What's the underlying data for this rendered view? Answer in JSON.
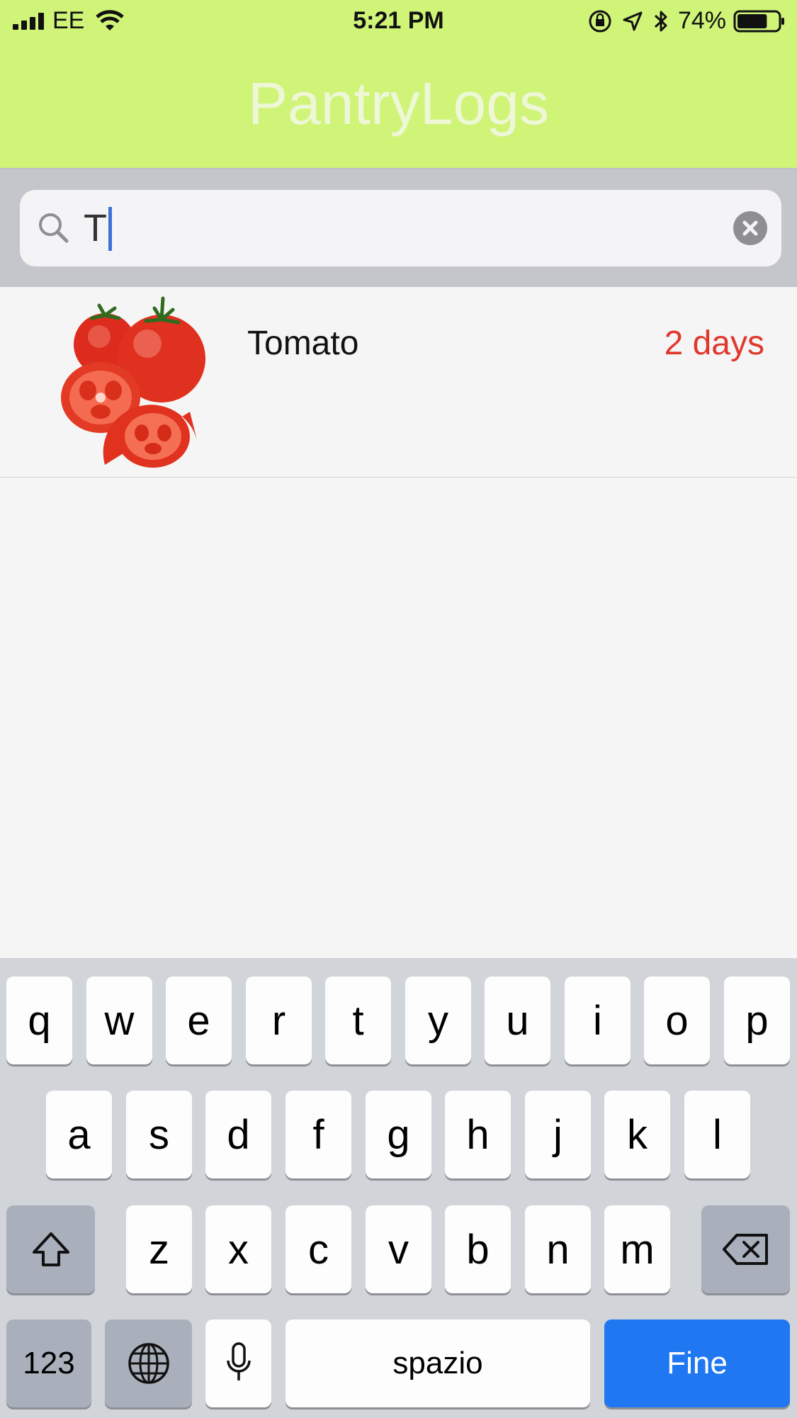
{
  "status_bar": {
    "carrier": "EE",
    "time": "5:21 PM",
    "battery": "74%",
    "battery_level": 0.74,
    "icons": [
      "signal-icon",
      "wifi-icon",
      "orientation-lock-icon",
      "location-icon",
      "bluetooth-icon",
      "battery-icon"
    ]
  },
  "header": {
    "title": "PantryLogs",
    "background_color": "#cff478"
  },
  "search": {
    "value": "T",
    "caret_color": "#3f6fd8"
  },
  "results": [
    {
      "name": "Tomato",
      "expiry": "2 days",
      "expiry_color": "#e0382c",
      "image": "tomato-image"
    }
  ],
  "keyboard": {
    "row1": [
      "q",
      "w",
      "e",
      "r",
      "t",
      "y",
      "u",
      "i",
      "o",
      "p"
    ],
    "row2": [
      "a",
      "s",
      "d",
      "f",
      "g",
      "h",
      "j",
      "k",
      "l"
    ],
    "row3": [
      "z",
      "x",
      "c",
      "v",
      "b",
      "n",
      "m"
    ],
    "numbers_label": "123",
    "space_label": "spazio",
    "return_label": "Fine",
    "return_color": "#1f77f2"
  }
}
